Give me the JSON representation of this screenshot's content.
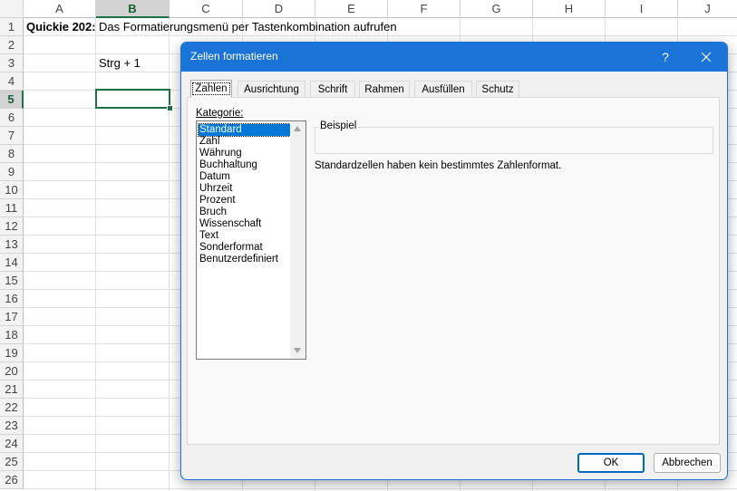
{
  "sheet": {
    "columns": [
      "A",
      "B",
      "C",
      "D",
      "E",
      "F",
      "G",
      "H",
      "I",
      "J"
    ],
    "rows": [
      "1",
      "2",
      "3",
      "4",
      "5",
      "6",
      "7",
      "8",
      "9",
      "10",
      "11",
      "12",
      "13",
      "14",
      "15",
      "16",
      "17",
      "18",
      "19",
      "20",
      "21",
      "22",
      "23",
      "24",
      "25",
      "26"
    ],
    "selected_column": "B",
    "selected_row": "5",
    "a1": "Quickie 202:",
    "b1": "Das Formatierungsmenü per Tastenkombination aufrufen",
    "b3": "Strg + 1"
  },
  "dialog": {
    "title": "Zellen formatieren",
    "help": "?",
    "tabs": [
      "Zahlen",
      "Ausrichtung",
      "Schrift",
      "Rahmen",
      "Ausfüllen",
      "Schutz"
    ],
    "active_tab": "Zahlen",
    "kategorie_label": "Kategorie:",
    "kategorien": [
      "Standard",
      "Zahl",
      "Währung",
      "Buchhaltung",
      "Datum",
      "Uhrzeit",
      "Prozent",
      "Bruch",
      "Wissenschaft",
      "Text",
      "Sonderformat",
      "Benutzerdefiniert"
    ],
    "selected_kategorie": "Standard",
    "beispiel_label": "Beispiel",
    "description": "Standardzellen haben kein bestimmtes Zahlenformat.",
    "ok_label": "OK",
    "cancel_label": "Abbrechen"
  },
  "colors": {
    "accent": "#1a73d6",
    "excel_green": "#1e7145",
    "selection": "#0078d7"
  }
}
